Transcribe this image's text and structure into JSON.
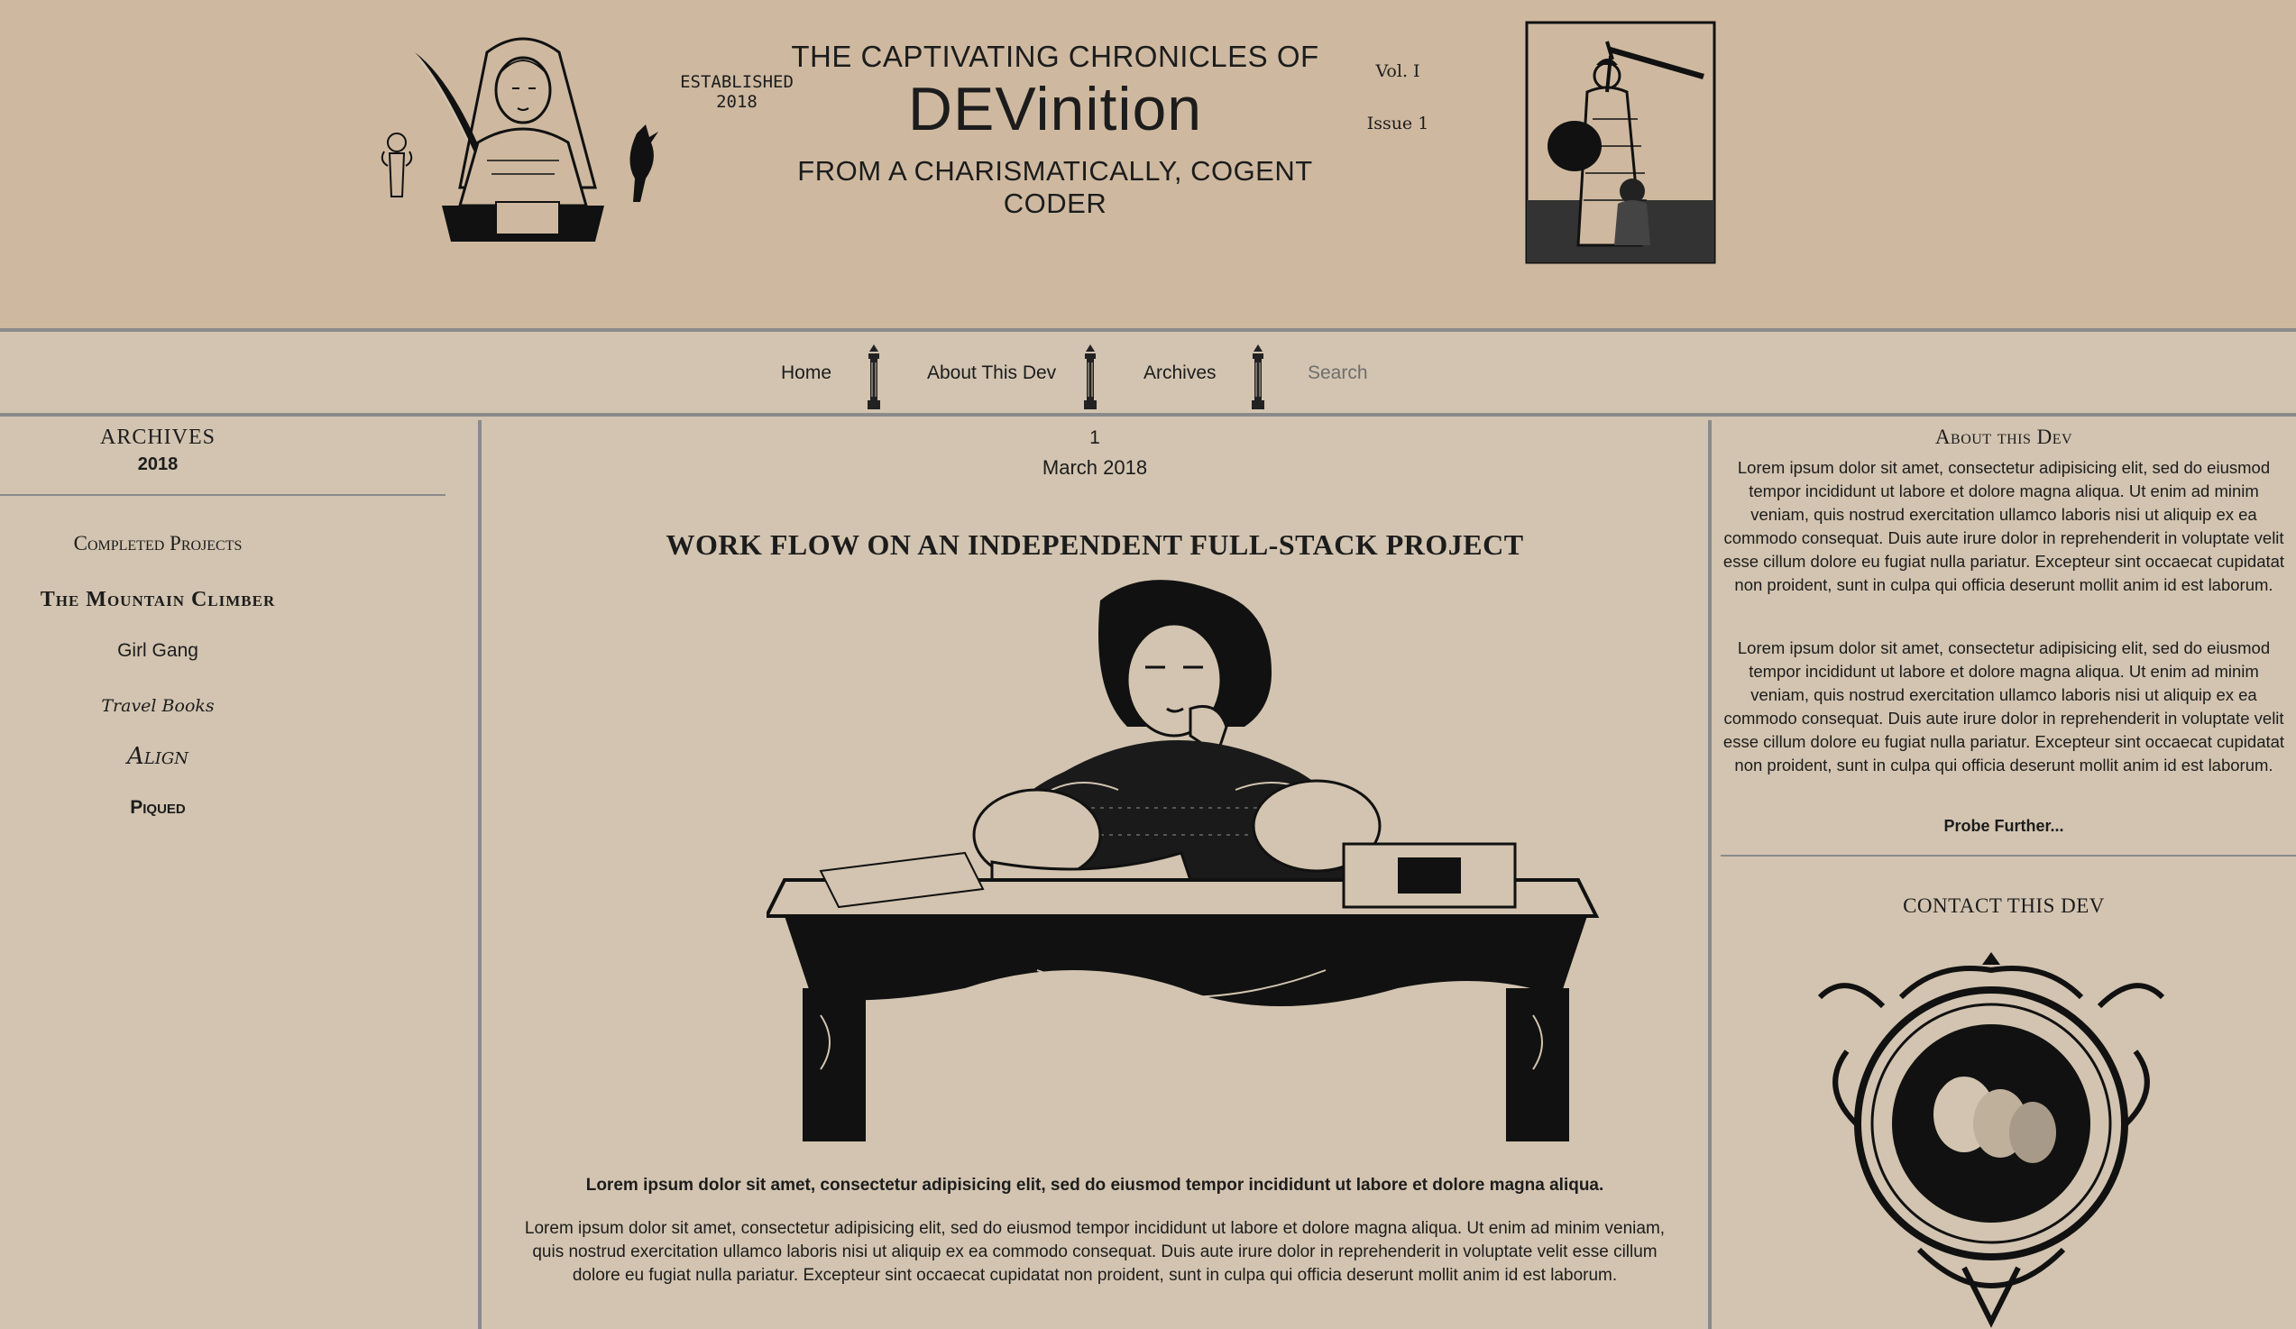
{
  "masthead": {
    "kicker": "THE CAPTIVATING CHRONICLES OF",
    "brand": "DEVinition",
    "byline": "FROM A CHARISMATICALLY, COGENT CODER",
    "established_line1": "ESTABLISHED",
    "established_line2": "2018",
    "volume": "Vol. I",
    "issue": "Issue 1"
  },
  "nav": {
    "items": [
      {
        "label": "Home"
      },
      {
        "label": "About This Dev"
      },
      {
        "label": "Archives"
      }
    ],
    "search_placeholder": "Search",
    "divider_icon": "column-pillar-icon"
  },
  "left_sidebar": {
    "archives_title": "ARCHIVES",
    "archives_year": "2018",
    "projects_title": "Completed Projects",
    "projects": [
      {
        "label": "The Mountain Climber"
      },
      {
        "label": "Girl Gang"
      },
      {
        "label": "Travel Books"
      },
      {
        "label": "Align"
      },
      {
        "label": "Piqued"
      }
    ]
  },
  "post": {
    "day": "1",
    "month": "March 2018",
    "title": "WORK FLOW ON AN INDEPENDENT FULL-STACK PROJECT",
    "lede": "Lorem ipsum dolor sit amet, consectetur adipisicing elit, sed do eiusmod tempor incididunt ut labore et dolore magna aliqua.",
    "body": "Lorem ipsum dolor sit amet, consectetur adipisicing elit, sed do eiusmod tempor incididunt ut labore et dolore magna aliqua. Ut enim ad minim veniam, quis nostrud exercitation ullamco laboris nisi ut aliquip ex ea commodo consequat. Duis aute irure dolor in reprehenderit in voluptate velit esse cillum dolore eu fugiat nulla pariatur. Excepteur sint occaecat cupidatat non proident, sunt in culpa qui officia deserunt mollit anim id est laborum."
  },
  "right_sidebar": {
    "about_title": "About this Dev",
    "about_paragraphs": [
      "Lorem ipsum dolor sit amet, consectetur adipisicing elit, sed do eiusmod tempor incididunt ut labore et dolore magna aliqua. Ut enim ad minim veniam, quis nostrud exercitation ullamco laboris nisi ut aliquip ex ea commodo consequat. Duis aute irure dolor in reprehenderit in voluptate velit esse cillum dolore eu fugiat nulla pariatur. Excepteur sint occaecat cupidatat non proident, sunt in culpa qui officia deserunt mollit anim id est laborum.",
      "Lorem ipsum dolor sit amet, consectetur adipisicing elit, sed do eiusmod tempor incididunt ut labore et dolore magna aliqua. Ut enim ad minim veniam, quis nostrud exercitation ullamco laboris nisi ut aliquip ex ea commodo consequat. Duis aute irure dolor in reprehenderit in voluptate velit esse cillum dolore eu fugiat nulla pariatur. Excepteur sint occaecat cupidatat non proident, sunt in culpa qui officia deserunt mollit anim id est laborum."
    ],
    "probe_link": "Probe Further...",
    "contact_title": "CONTACT THIS DEV"
  },
  "colors": {
    "masthead_bg": "#ceb9a0",
    "page_bg": "#d2c4b0",
    "rule": "#8a8a8a",
    "ink": "#1c1c1c"
  }
}
